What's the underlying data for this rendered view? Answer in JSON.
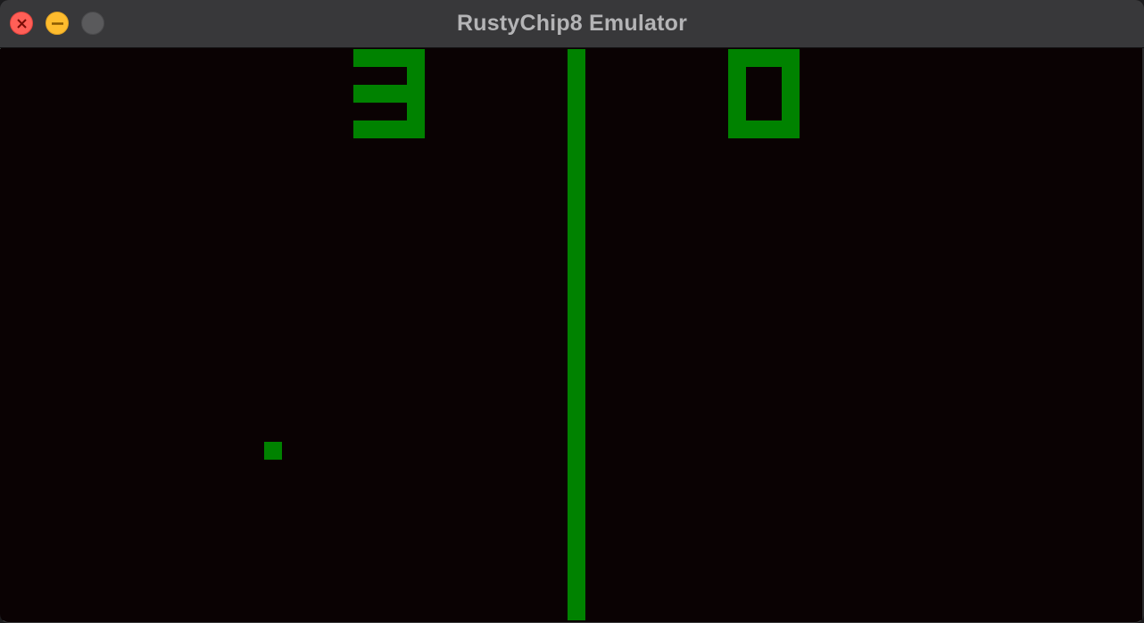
{
  "window": {
    "title": "RustyChip8 Emulator"
  },
  "game": {
    "left_score": 3,
    "right_score": 0,
    "pixel_color": "#008200",
    "background_color": "#0a0203",
    "display_resolution": "64x32"
  },
  "icons": {
    "close": "close-icon",
    "minimize": "minimize-icon",
    "zoom": "zoom-icon"
  }
}
